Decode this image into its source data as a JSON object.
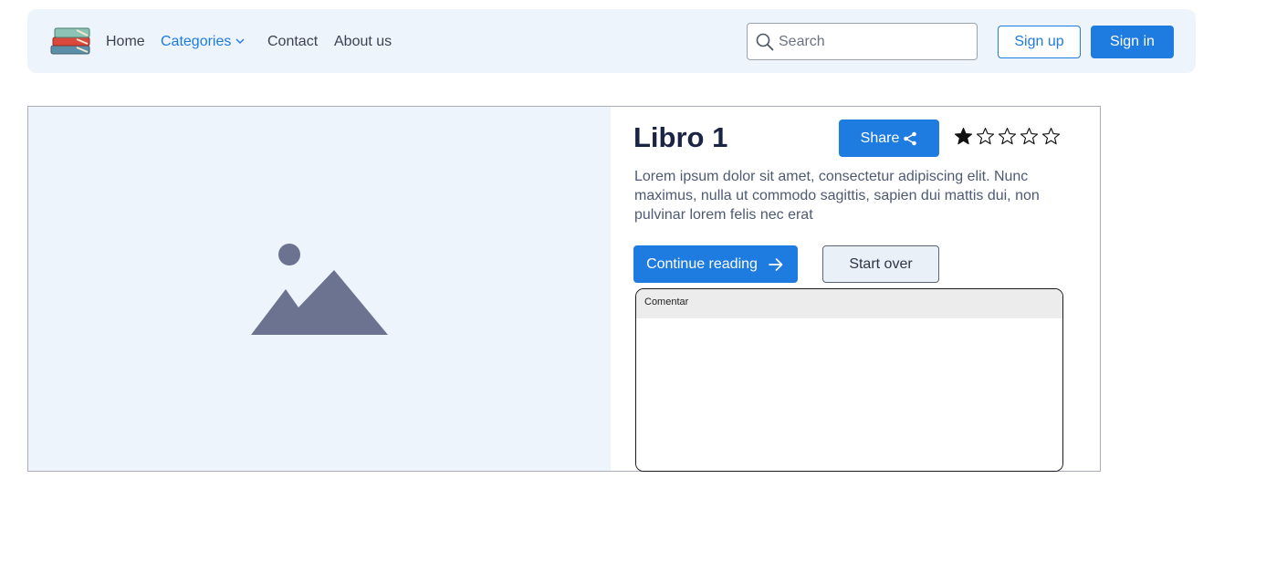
{
  "nav": {
    "logo_icon": "books-stack-icon",
    "links": [
      {
        "label": "Home"
      },
      {
        "label": "Categories"
      },
      {
        "label": "Contact"
      },
      {
        "label": "About us"
      }
    ],
    "search": {
      "placeholder": "Search",
      "value": ""
    },
    "signup_label": "Sign up",
    "signin_label": "Sign in"
  },
  "book": {
    "title": "Libro 1",
    "share_label": "Share",
    "rating": 1,
    "max_rating": 5,
    "description": "Lorem ipsum dolor sit amet, consectetur adipiscing elit. Nunc maximus, nulla ut commodo sagittis, sapien dui mattis dui, non pulvinar lorem felis nec erat",
    "continue_label": "Continue reading",
    "start_over_label": "Start over"
  },
  "comment": {
    "header": "Comentar",
    "value": ""
  },
  "colors": {
    "accent": "#1e7be0",
    "navbar_bg": "#eef4fc",
    "title": "#1b2444"
  }
}
